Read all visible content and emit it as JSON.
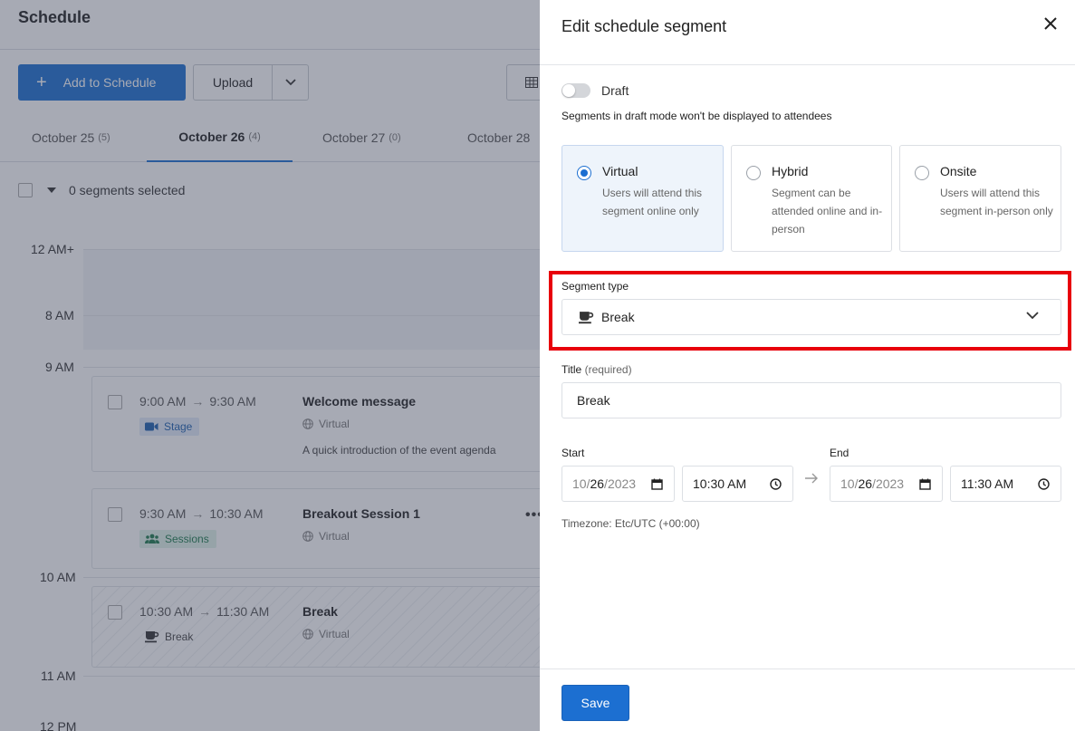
{
  "page": {
    "title": "Schedule",
    "add_button": "Add to Schedule",
    "upload_button": "Upload",
    "tabs": [
      {
        "label": "October 25",
        "count": "(5)"
      },
      {
        "label": "October 26",
        "count": "(4)"
      },
      {
        "label": "October 27",
        "count": "(0)"
      },
      {
        "label": "October 28",
        "count": ""
      }
    ],
    "selection_text": "0 segments selected",
    "time_labels": [
      "12 AM+",
      "8 AM",
      "9 AM",
      "10 AM",
      "11 AM",
      "12 PM"
    ],
    "time_arrow": "→",
    "more": "•••",
    "segments": [
      {
        "start": "9:00 AM",
        "end": "9:30 AM",
        "badge": "Stage",
        "title": "Welcome message",
        "location": "Virtual",
        "description": "A quick introduction of the event agenda"
      },
      {
        "start": "9:30 AM",
        "end": "10:30 AM",
        "badge": "Sessions",
        "title": "Breakout Session 1",
        "location": "Virtual",
        "description": ""
      },
      {
        "start": "10:30 AM",
        "end": "11:30 AM",
        "badge": "Break",
        "title": "Break",
        "location": "Virtual",
        "description": ""
      }
    ]
  },
  "drawer": {
    "title": "Edit schedule segment",
    "draft_label": "Draft",
    "draft_hint": "Segments in draft mode won't be displayed to attendees",
    "modes": [
      {
        "title": "Virtual",
        "description": "Users will attend this segment online only",
        "selected": true
      },
      {
        "title": "Hybrid",
        "description": "Segment can be attended online and in-person",
        "selected": false
      },
      {
        "title": "Onsite",
        "description": "Users will attend this segment in-person only",
        "selected": false
      }
    ],
    "segment_type_label": "Segment type",
    "segment_type_value": "Break",
    "title_label": "Title",
    "title_required": "(required)",
    "title_value": "Break",
    "start_label": "Start",
    "end_label": "End",
    "start_date": {
      "mm": "10",
      "dd": "26",
      "yyyy": "2023"
    },
    "start_time": "10:30 AM",
    "end_date": {
      "mm": "10",
      "dd": "26",
      "yyyy": "2023"
    },
    "end_time": "11:30 AM",
    "timezone": "Timezone: Etc/UTC (+00:00)",
    "save_button": "Save"
  },
  "colors": {
    "accent": "#1c6fd1",
    "highlight": "#e8000b",
    "overlay": "#3c4358"
  }
}
